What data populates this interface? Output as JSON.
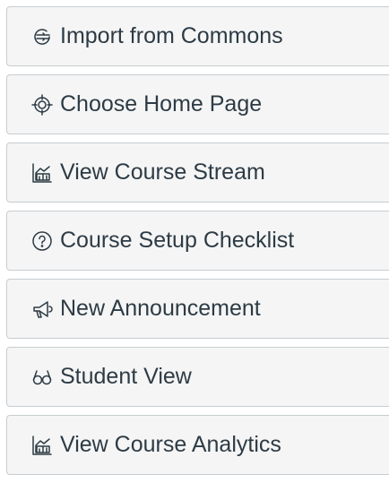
{
  "course_actions": {
    "buttons": [
      {
        "label": "Import from Commons",
        "icon": "commons-icon"
      },
      {
        "label": "Choose Home Page",
        "icon": "target-icon"
      },
      {
        "label": "View Course Stream",
        "icon": "stream-icon"
      },
      {
        "label": "Course Setup Checklist",
        "icon": "question-circle-icon"
      },
      {
        "label": "New Announcement",
        "icon": "megaphone-icon"
      },
      {
        "label": "Student View",
        "icon": "glasses-icon"
      },
      {
        "label": "View Course Analytics",
        "icon": "analytics-icon"
      }
    ]
  },
  "colors": {
    "text": "#2d3b45",
    "button_bg": "#f5f5f5",
    "border": "#c7cdd1"
  }
}
